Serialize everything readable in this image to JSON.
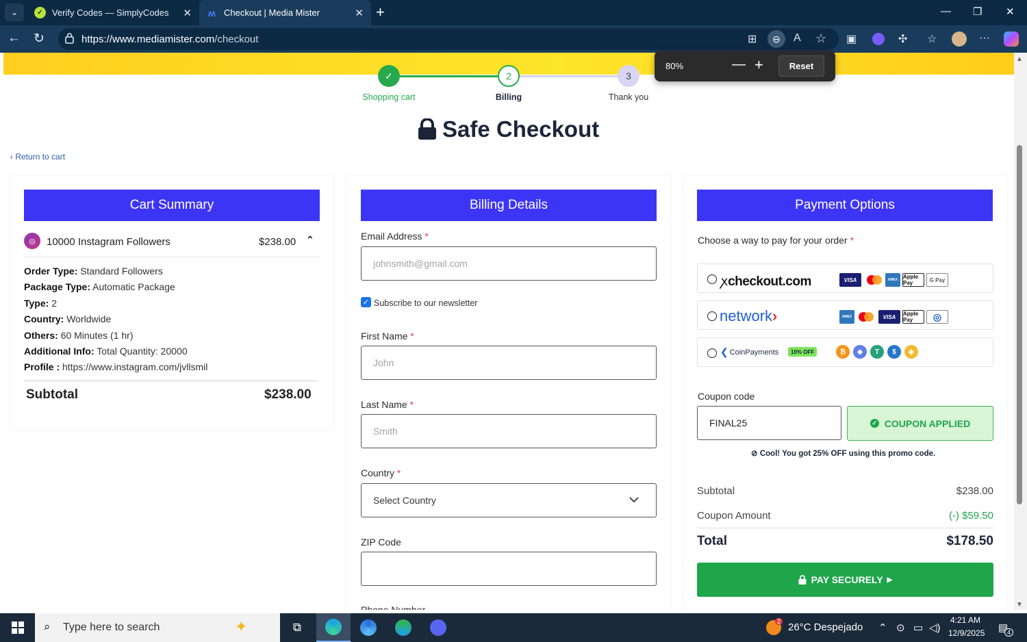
{
  "browser": {
    "tabs": [
      {
        "title": "Verify Codes — SimplyCodes",
        "active": false
      },
      {
        "title": "Checkout | Media Mister",
        "active": true
      }
    ],
    "url_host": "https://www.mediamister.com",
    "url_path": "/checkout",
    "zoom": {
      "level": "80%",
      "reset_label": "Reset"
    }
  },
  "progress": {
    "steps": [
      {
        "num": "",
        "label": "Shopping cart",
        "state": "done"
      },
      {
        "num": "2",
        "label": "Billing",
        "state": "current"
      },
      {
        "num": "3",
        "label": "Thank you",
        "state": "todo"
      }
    ]
  },
  "page": {
    "title": "Safe Checkout",
    "return_link": "Return to cart"
  },
  "cart": {
    "heading": "Cart Summary",
    "item_name": "10000 Instagram Followers",
    "item_price": "$238.00",
    "details": [
      {
        "label": "Order Type:",
        "value": "Standard Followers"
      },
      {
        "label": "Package Type:",
        "value": "Automatic Package"
      },
      {
        "label": "Type:",
        "value": "2"
      },
      {
        "label": "Country:",
        "value": "Worldwide"
      },
      {
        "label": "Others:",
        "value": "60 Minutes (1 hr)"
      },
      {
        "label": "Additional Info:",
        "value": "Total Quantity: 20000"
      },
      {
        "label": "Profile :",
        "value": "https://www.instagram.com/jvllsmil"
      }
    ],
    "subtotal_label": "Subtotal",
    "subtotal_value": "$238.00"
  },
  "billing": {
    "heading": "Billing Details",
    "email_label": "Email Address",
    "email_placeholder": "johnsmith@gmail.com",
    "newsletter_label": "Subscribe to our newsletter",
    "newsletter_checked": true,
    "first_label": "First Name",
    "first_placeholder": "John",
    "last_label": "Last Name",
    "last_placeholder": "Smith",
    "country_label": "Country",
    "country_value": "Select Country",
    "zip_label": "ZIP Code",
    "zip_value": "",
    "phone_label": "Phone Number",
    "required_mark": "*"
  },
  "payment": {
    "heading": "Payment Options",
    "prompt": "Choose a way to pay for your order",
    "options": [
      {
        "name": "checkout.com",
        "logos": [
          "VISA",
          "mastercard",
          "AMEX",
          "Apple Pay",
          "G Pay"
        ]
      },
      {
        "name": "network",
        "logos": [
          "AMEX",
          "mastercard",
          "VISA",
          "Apple Pay",
          "Diners"
        ]
      },
      {
        "name": "CoinPayments",
        "badge": "10% OFF",
        "logos": [
          "BTC",
          "ETH",
          "USDT",
          "USDC",
          "BNB"
        ]
      }
    ],
    "coupon_label": "Coupon code",
    "coupon_value": "FINAL25",
    "coupon_status": "COUPON APPLIED",
    "coupon_message": "Cool! You got 25% OFF using this promo code.",
    "subtotal_label": "Subtotal",
    "subtotal_value": "$238.00",
    "coupon_amount_label": "Coupon Amount",
    "coupon_amount_value": "(-) $59.50",
    "total_label": "Total",
    "total_value": "$178.50",
    "pay_button": "PAY SECURELY",
    "colors": {
      "brand": "#3d35f5",
      "success": "#1fa54a",
      "banner": "#fde52a"
    }
  },
  "taskbar": {
    "search_placeholder": "Type here to search",
    "weather": "26°C  Despejado",
    "weather_badge": "2",
    "time": "4:21 AM",
    "date": "12/9/2025",
    "notifications": "4"
  }
}
